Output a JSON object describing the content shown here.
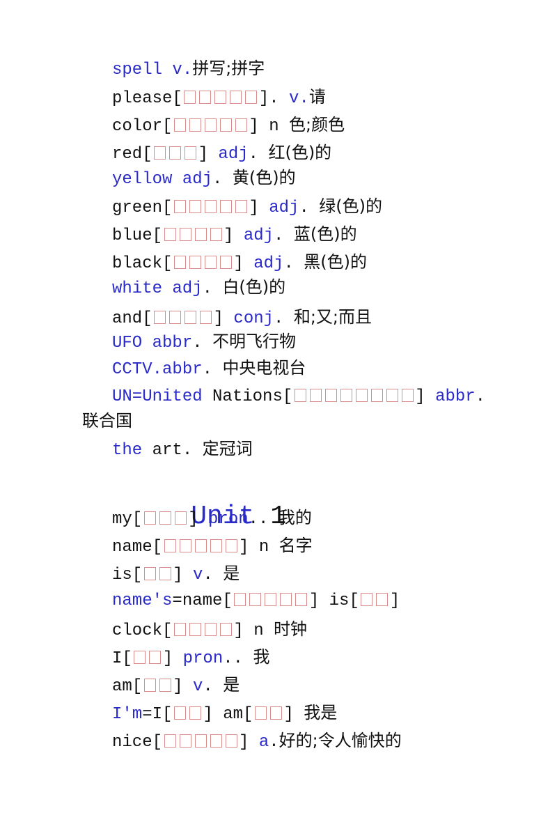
{
  "document": {
    "colors": {
      "keyword_blue": "#2a2ac8",
      "text_black": "#111111",
      "missing_glyph_box": "#d98a8a"
    },
    "entries_before_unit": [
      {
        "segments": [
          {
            "t": "spell v.",
            "c": "blue"
          },
          {
            "t": "拼写;拼字",
            "c": "cjk"
          }
        ]
      },
      {
        "segments": [
          {
            "t": "please[",
            "c": "black"
          },
          {
            "boxes": 5
          },
          {
            "t": "]. ",
            "c": "black"
          },
          {
            "t": "v.",
            "c": "blue"
          },
          {
            "t": "请",
            "c": "cjk"
          }
        ]
      },
      {
        "segments": [
          {
            "t": "color[",
            "c": "black"
          },
          {
            "boxes": 5
          },
          {
            "t": "] n ",
            "c": "black"
          },
          {
            "t": "色;颜色",
            "c": "cjk"
          }
        ]
      },
      {
        "segments": [
          {
            "t": "red[",
            "c": "black"
          },
          {
            "boxes": 3
          },
          {
            "t": "] ",
            "c": "black"
          },
          {
            "t": "adj",
            "c": "blue"
          },
          {
            "t": ". ",
            "c": "black"
          },
          {
            "t": "红(色)的",
            "c": "cjk"
          }
        ]
      },
      {
        "segments": [
          {
            "t": "yellow adj",
            "c": "blue"
          },
          {
            "t": ". ",
            "c": "black"
          },
          {
            "t": "黄(色)的",
            "c": "cjk"
          }
        ]
      },
      {
        "segments": [
          {
            "t": "green[",
            "c": "black"
          },
          {
            "boxes": 5
          },
          {
            "t": "] ",
            "c": "black"
          },
          {
            "t": "adj",
            "c": "blue"
          },
          {
            "t": ". ",
            "c": "black"
          },
          {
            "t": "绿(色)的",
            "c": "cjk"
          }
        ]
      },
      {
        "segments": [
          {
            "t": "blue[",
            "c": "black"
          },
          {
            "boxes": 4
          },
          {
            "t": "] ",
            "c": "black"
          },
          {
            "t": "adj",
            "c": "blue"
          },
          {
            "t": ". ",
            "c": "black"
          },
          {
            "t": "蓝(色)的",
            "c": "cjk"
          }
        ]
      },
      {
        "segments": [
          {
            "t": "black[",
            "c": "black"
          },
          {
            "boxes": 4
          },
          {
            "t": "] ",
            "c": "black"
          },
          {
            "t": "adj",
            "c": "blue"
          },
          {
            "t": ". ",
            "c": "black"
          },
          {
            "t": "黑(色)的",
            "c": "cjk"
          }
        ]
      },
      {
        "segments": [
          {
            "t": "white adj",
            "c": "blue"
          },
          {
            "t": ". ",
            "c": "black"
          },
          {
            "t": "白(色)的",
            "c": "cjk"
          }
        ]
      },
      {
        "segments": [
          {
            "t": "and[",
            "c": "black"
          },
          {
            "boxes": 4
          },
          {
            "t": "] ",
            "c": "black"
          },
          {
            "t": "conj",
            "c": "blue"
          },
          {
            "t": ". ",
            "c": "black"
          },
          {
            "t": "和;又;而且",
            "c": "cjk"
          }
        ]
      },
      {
        "segments": [
          {
            "t": "UFO abbr",
            "c": "blue"
          },
          {
            "t": ". ",
            "c": "black"
          },
          {
            "t": "不明飞行物",
            "c": "cjk"
          }
        ]
      },
      {
        "segments": [
          {
            "t": "CCTV.abbr",
            "c": "blue"
          },
          {
            "t": ". ",
            "c": "black"
          },
          {
            "t": "中央电视台",
            "c": "cjk"
          }
        ]
      },
      {
        "segments": [
          {
            "t": "UN=United",
            "c": "blue"
          },
          {
            "t": " Nations[",
            "c": "black"
          },
          {
            "boxes": 8
          },
          {
            "t": "] ",
            "c": "black"
          },
          {
            "t": "abbr",
            "c": "blue"
          },
          {
            "t": ".",
            "c": "black"
          }
        ],
        "wrap": "联合国"
      },
      {
        "segments": [
          {
            "t": "the",
            "c": "blue"
          },
          {
            "t": " art. ",
            "c": "black"
          },
          {
            "t": "定冠词",
            "c": "cjk"
          }
        ]
      }
    ],
    "unit_heading": {
      "word": "Unit",
      "number": "1"
    },
    "entries_after_unit": [
      {
        "segments": [
          {
            "t": "my[",
            "c": "black"
          },
          {
            "boxes": 3
          },
          {
            "t": "] ",
            "c": "black"
          },
          {
            "t": "pron",
            "c": "blue"
          },
          {
            "t": ".. ",
            "c": "black"
          },
          {
            "t": "我的",
            "c": "cjk"
          }
        ]
      },
      {
        "segments": [
          {
            "t": "name[",
            "c": "black"
          },
          {
            "boxes": 5
          },
          {
            "t": "] n ",
            "c": "black"
          },
          {
            "t": "名字",
            "c": "cjk"
          }
        ]
      },
      {
        "segments": [
          {
            "t": "is[",
            "c": "black"
          },
          {
            "boxes": 2
          },
          {
            "t": "] ",
            "c": "black"
          },
          {
            "t": "v",
            "c": "blue"
          },
          {
            "t": ". ",
            "c": "black"
          },
          {
            "t": "是",
            "c": "cjk"
          }
        ]
      },
      {
        "segments": [
          {
            "t": "name's",
            "c": "blue"
          },
          {
            "t": "=name[",
            "c": "black"
          },
          {
            "boxes": 5
          },
          {
            "t": "] is[",
            "c": "black"
          },
          {
            "boxes": 2
          },
          {
            "t": "]",
            "c": "black"
          }
        ]
      },
      {
        "segments": [
          {
            "t": "clock[",
            "c": "black"
          },
          {
            "boxes": 4
          },
          {
            "t": "] n ",
            "c": "black"
          },
          {
            "t": "时钟",
            "c": "cjk"
          }
        ]
      },
      {
        "segments": [
          {
            "t": "I[",
            "c": "black"
          },
          {
            "boxes": 2
          },
          {
            "t": "] ",
            "c": "black"
          },
          {
            "t": "pron",
            "c": "blue"
          },
          {
            "t": ".. ",
            "c": "black"
          },
          {
            "t": "我",
            "c": "cjk"
          }
        ]
      },
      {
        "segments": [
          {
            "t": "am[",
            "c": "black"
          },
          {
            "boxes": 2
          },
          {
            "t": "] ",
            "c": "black"
          },
          {
            "t": "v",
            "c": "blue"
          },
          {
            "t": ". ",
            "c": "black"
          },
          {
            "t": "是",
            "c": "cjk"
          }
        ]
      },
      {
        "segments": [
          {
            "t": "I'm",
            "c": "blue"
          },
          {
            "t": "=I[",
            "c": "black"
          },
          {
            "boxes": 2
          },
          {
            "t": "] am[",
            "c": "black"
          },
          {
            "boxes": 2
          },
          {
            "t": "] ",
            "c": "black"
          },
          {
            "t": "我是",
            "c": "cjk"
          }
        ]
      },
      {
        "segments": [
          {
            "t": "nice[",
            "c": "black"
          },
          {
            "boxes": 5
          },
          {
            "t": "] ",
            "c": "black"
          },
          {
            "t": "a",
            "c": "blue"
          },
          {
            "t": ".",
            "c": "black"
          },
          {
            "t": "好的;令人愉快的",
            "c": "cjk"
          }
        ]
      }
    ]
  }
}
